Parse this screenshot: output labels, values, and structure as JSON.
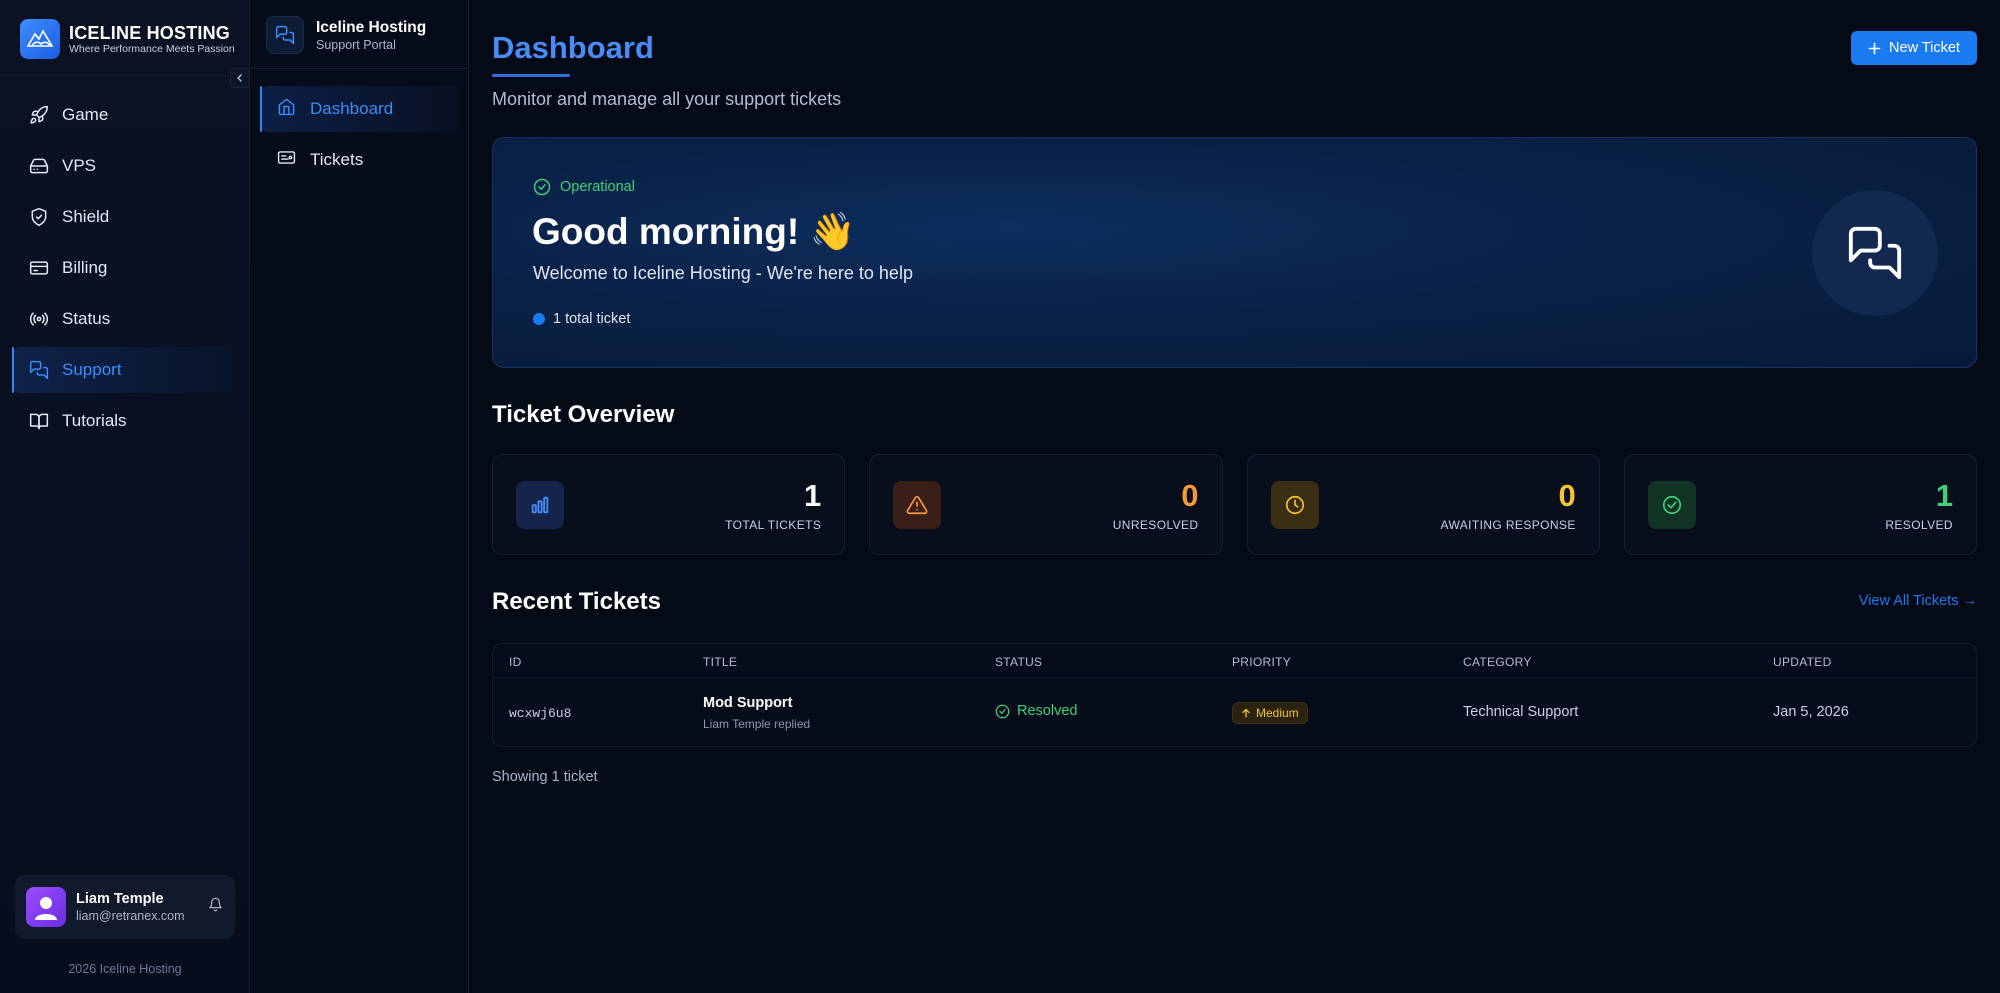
{
  "brand": {
    "name": "ICELINE HOSTING",
    "tagline": "Where Performance Meets Passion"
  },
  "sidebar": {
    "items": [
      {
        "label": "Game",
        "icon": "rocket-icon",
        "active": false
      },
      {
        "label": "VPS",
        "icon": "server-icon",
        "active": false
      },
      {
        "label": "Shield",
        "icon": "shield-icon",
        "active": false
      },
      {
        "label": "Billing",
        "icon": "credit-card-icon",
        "active": false
      },
      {
        "label": "Status",
        "icon": "broadcast-icon",
        "active": false
      },
      {
        "label": "Support",
        "icon": "chat-icon",
        "active": true
      },
      {
        "label": "Tutorials",
        "icon": "book-icon",
        "active": false
      }
    ]
  },
  "user": {
    "name": "Liam Temple",
    "email": "liam@retranex.com"
  },
  "footer": {
    "copyright": "2026 Iceline Hosting"
  },
  "subnav": {
    "title": "Iceline Hosting",
    "subtitle": "Support Portal",
    "items": [
      {
        "label": "Dashboard",
        "icon": "home-icon",
        "active": true
      },
      {
        "label": "Tickets",
        "icon": "ticket-icon",
        "active": false
      }
    ]
  },
  "page": {
    "title": "Dashboard",
    "subtitle": "Monitor and manage all your support tickets",
    "new_ticket_label": "New Ticket"
  },
  "hero": {
    "status": "Operational",
    "greeting": "Good morning! 👋",
    "welcome": "Welcome to Iceline Hosting - We're here to help",
    "ticket_count": "1 total ticket"
  },
  "overview": {
    "title": "Ticket Overview",
    "stats": [
      {
        "value": "1",
        "label": "Total Tickets",
        "color": "#ffffff",
        "icon": "bar-chart-icon"
      },
      {
        "value": "0",
        "label": "Unresolved",
        "color": "#f59a3c",
        "icon": "warning-icon"
      },
      {
        "value": "0",
        "label": "Awaiting Response",
        "color": "#f4c434",
        "icon": "clock-icon"
      },
      {
        "value": "1",
        "label": "Resolved",
        "color": "#3ed07a",
        "icon": "check-circle-icon"
      }
    ]
  },
  "recent": {
    "title": "Recent Tickets",
    "view_all": "View All Tickets →",
    "columns": [
      "ID",
      "Title",
      "Status",
      "Priority",
      "Category",
      "Updated"
    ],
    "rows": [
      {
        "id": "wcxwj6u8",
        "title": "Mod Support",
        "subtitle": "Liam Temple replied",
        "status": "Resolved",
        "priority": "Medium",
        "category": "Technical Support",
        "updated": "Jan 5, 2026"
      }
    ],
    "showing": "Showing 1 ticket"
  },
  "colors": {
    "accent": "#1a7af0",
    "success": "#3ed07a",
    "warning": "#f59a3c",
    "pending": "#f4c434",
    "background": "#050a17"
  }
}
